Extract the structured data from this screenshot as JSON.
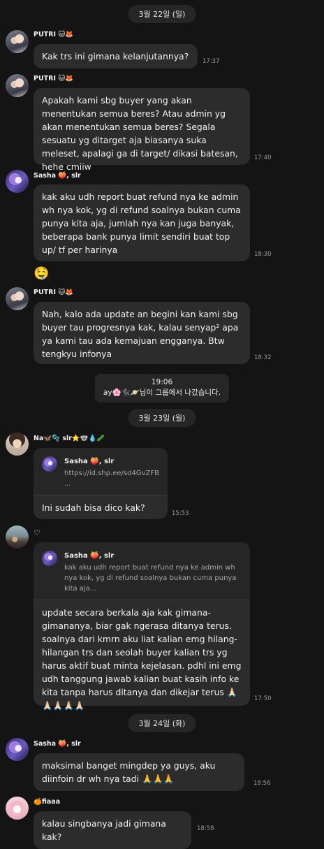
{
  "dates": {
    "d1": "3월 22일 (일)",
    "d2": "3월 23일 (월)",
    "d3": "3월 24일 (화)"
  },
  "system": {
    "time": "19:06",
    "text": "ay🌸🐈‍⬛🪐님이 그룹에서 나갔습니다."
  },
  "messages": [
    {
      "sender": "PUTRI 🐱🦊",
      "text": "Kak trs ini gimana kelanjutannya?",
      "time": "17:37"
    },
    {
      "sender": "PUTRI 🐱🦊",
      "text": "Apakah kami sbg buyer yang akan menentukan semua beres? Atau admin yg akan menentukan semua beres? Segala sesuatu yg ditarget aja biasanya suka meleset, apalagi ga di target/ dikasi batesan, hehe cmiiw",
      "time": "17:40"
    },
    {
      "sender": "Sasha 🍑, slr",
      "text": "kak aku udh report buat refund nya ke admin wh nya kok, yg di refund soalnya bukan cuma punya kita aja, jumlah nya kan juga banyak, beberapa bank punya limit sendiri buat top up/ tf per harinya",
      "time": "18:30"
    },
    {
      "sticker": "🤤"
    },
    {
      "sender": "PUTRI 🐱🦊",
      "text": "Nah, kalo ada update an begini kan kami sbg buyer tau progresnya kak, kalau senyap² apa ya kami tau ada kemajuan engganya. Btw tengkyu infonya",
      "time": "18:32"
    },
    {
      "sender": "Na🦋🫧 slr⭐🐨💧🥒",
      "reply_name": "Sasha 🍑, slr",
      "reply_text": "https://id.shp.ee/sd4GvZFB ...",
      "text": "Ini sudah bisa dico kak?",
      "time": "15:53"
    },
    {
      "sender": "♡",
      "reply_name": "Sasha 🍑, slr",
      "reply_text": "kak aku udh report buat refund nya ke admin wh nya kok, yg di refund soalnya bukan cuma punya kita aja...",
      "text": "update secara berkala aja kak gimana-gimananya, biar gak ngerasa ditanya terus. soalnya dari kmrn aku liat kalian emg hilang-hilangan trs dan seolah buyer kalian trs yg harus aktif buat minta kejelasan. pdhl ini emg udh tanggung jawab kalian buat kasih info ke kita tanpa harus ditanya dan dikejar terus 🙏🏻🙏🏻🙏🏻🙏🏻🙏🏻",
      "time": "17:50"
    },
    {
      "sender": "Sasha 🍑, slr",
      "text": "maksimal banget mingdep ya guys, aku diinfoin dr wh nya tadi 🙏🙏🙏",
      "time": "18:56"
    },
    {
      "sender": "🍊fiaaa",
      "text": "kalau singbanya jadi gimana kak?",
      "time": "18:58"
    }
  ]
}
